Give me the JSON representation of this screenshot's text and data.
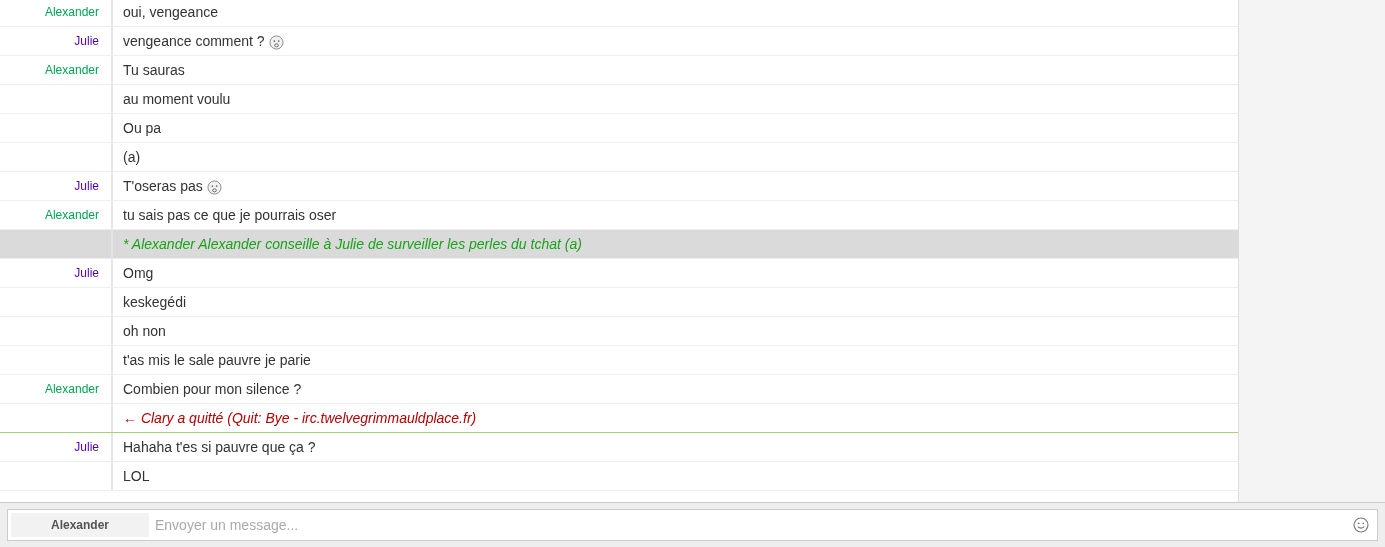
{
  "messages": [
    {
      "kind": "message",
      "nick": "Alexander",
      "color": "#00a651",
      "text": "oui, vengeance",
      "emoji": false,
      "marker_after": false
    },
    {
      "kind": "message",
      "nick": "Julie",
      "color": "#5400b3",
      "text": "vengeance comment ?",
      "emoji": true,
      "marker_after": false
    },
    {
      "kind": "message",
      "nick": "Alexander",
      "color": "#00a651",
      "text": "Tu sauras",
      "emoji": false,
      "marker_after": false
    },
    {
      "kind": "message",
      "text": "au moment voulu",
      "emoji": false,
      "marker_after": false
    },
    {
      "kind": "message",
      "text": "Ou pa",
      "emoji": false,
      "marker_after": false
    },
    {
      "kind": "message",
      "text": "(a)",
      "emoji": false,
      "marker_after": false
    },
    {
      "kind": "message",
      "nick": "Julie",
      "color": "#5400b3",
      "text": "T'oseras pas",
      "emoji": true,
      "marker_after": false
    },
    {
      "kind": "message",
      "nick": "Alexander",
      "color": "#00a651",
      "text": "tu sais pas ce que je pourrais oser",
      "emoji": false,
      "marker_after": false
    },
    {
      "kind": "action",
      "text": "* Alexander Alexander conseille à Julie de surveiller les perles du tchat (a)",
      "emoji": false,
      "marker_after": false
    },
    {
      "kind": "message",
      "nick": "Julie",
      "color": "#5400b3",
      "text": "Omg",
      "emoji": false,
      "marker_after": false
    },
    {
      "kind": "message",
      "text": "keskegédi",
      "emoji": false,
      "marker_after": false
    },
    {
      "kind": "message",
      "text": "oh non",
      "emoji": false,
      "marker_after": false
    },
    {
      "kind": "message",
      "text": "t'as mis le sale pauvre je parie",
      "emoji": false,
      "marker_after": false
    },
    {
      "kind": "message",
      "nick": "Alexander",
      "color": "#00a651",
      "text": "Combien pour mon silence ?",
      "emoji": false,
      "marker_after": false
    },
    {
      "kind": "quit",
      "text": "← Clary a quitté (Quit: Bye - irc.twelvegrimmauldplace.fr)",
      "emoji": false,
      "marker_after": true
    },
    {
      "kind": "message",
      "nick": "Julie",
      "color": "#5400b3",
      "text": "Hahaha t'es si pauvre que ça ?",
      "emoji": false,
      "marker_after": false
    },
    {
      "kind": "message",
      "text": "LOL",
      "emoji": false,
      "marker_after": false
    }
  ],
  "composer": {
    "nick": "Alexander",
    "placeholder": "Envoyer un message..."
  }
}
